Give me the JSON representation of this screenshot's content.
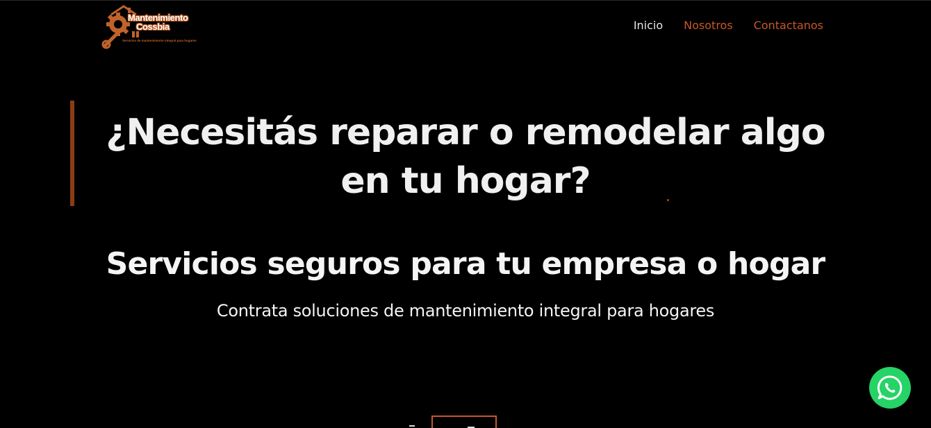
{
  "header": {
    "logo": {
      "title": "Mantenimiento",
      "subtitle": "Cossbia",
      "tagline": "Servicios de mantenimiento integral para hogares",
      "icon": "wrench-gear-house-icon"
    },
    "nav": {
      "items": [
        {
          "label": "Inicio",
          "active": true
        },
        {
          "label": "Nosotros",
          "active": false
        },
        {
          "label": "Contactanos",
          "active": false
        }
      ]
    }
  },
  "hero": {
    "title": "¿Necesitás reparar o remodelar algo en tu hogar?",
    "subtitle": "Servicios seguros para tu empresa o hogar",
    "description": "Contrata soluciones de mantenimiento integral para hogares"
  },
  "floating": {
    "whatsapp_icon": "whatsapp-icon"
  },
  "colors": {
    "background": "#000000",
    "accent": "#c8562a",
    "bar": "#8a3d13",
    "whatsapp": "#25d366",
    "text": "#f2f2f2"
  }
}
